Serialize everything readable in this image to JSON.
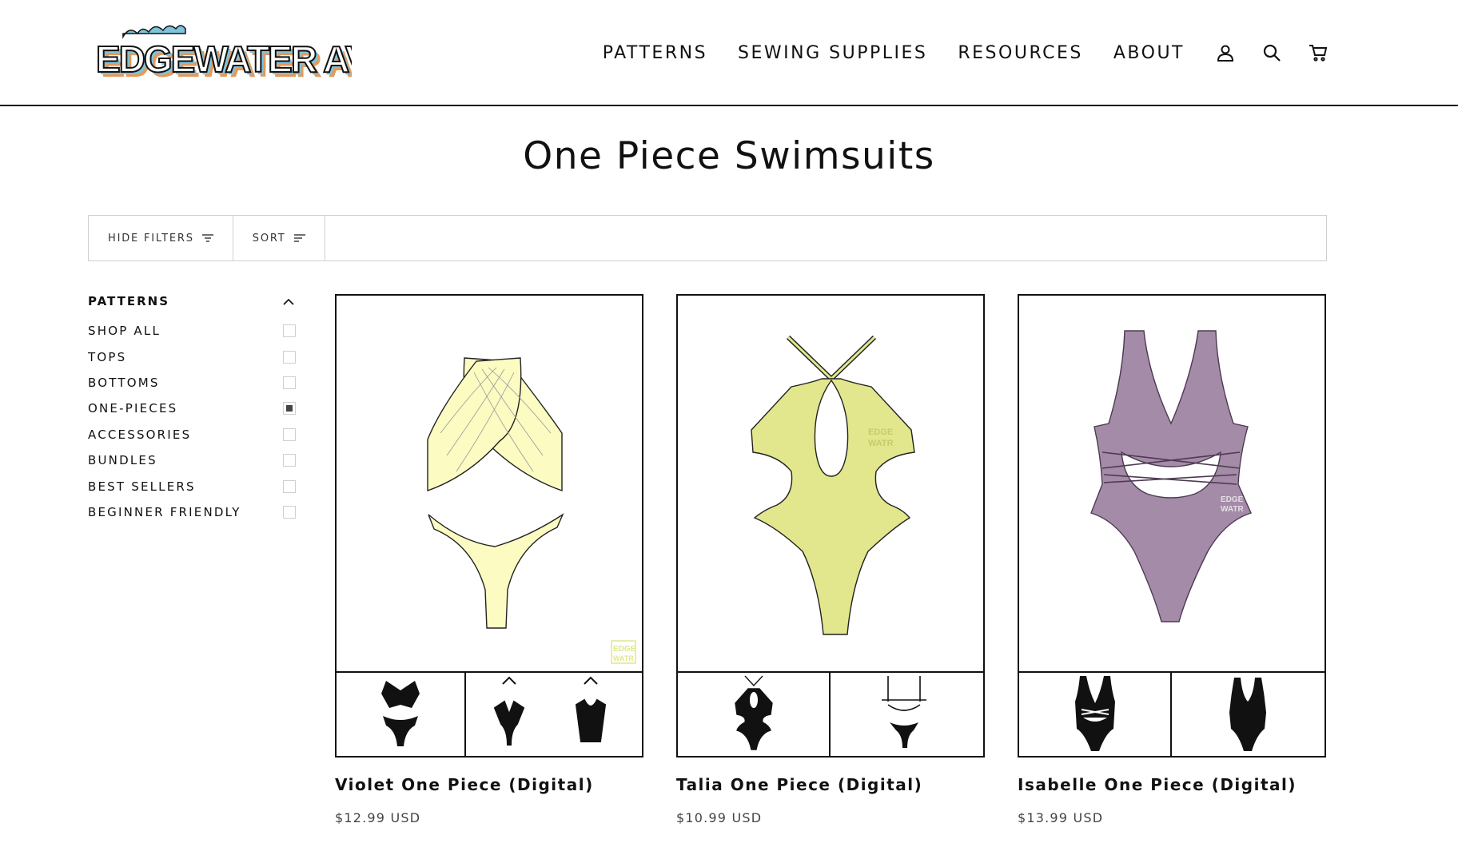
{
  "logo": {
    "text": "EDGEWATER AVE"
  },
  "nav": {
    "items": [
      {
        "label": "PATTERNS"
      },
      {
        "label": "SEWING SUPPLIES"
      },
      {
        "label": "RESOURCES"
      },
      {
        "label": "ABOUT"
      }
    ],
    "icons": [
      "account-icon",
      "search-icon",
      "cart-icon"
    ]
  },
  "page": {
    "title": "One Piece Swimsuits"
  },
  "toolbar": {
    "hide_filters_label": "HIDE FILTERS",
    "sort_label": "SORT"
  },
  "sidebar": {
    "heading": "PATTERNS",
    "filters": [
      {
        "label": "SHOP ALL",
        "checked": false
      },
      {
        "label": "TOPS",
        "checked": false
      },
      {
        "label": "BOTTOMS",
        "checked": false
      },
      {
        "label": "ONE-PIECES",
        "checked": true
      },
      {
        "label": "ACCESSORIES",
        "checked": false
      },
      {
        "label": "BUNDLES",
        "checked": false
      },
      {
        "label": "BEST SELLERS",
        "checked": false
      },
      {
        "label": "BEGINNER FRIENDLY",
        "checked": false
      }
    ]
  },
  "products": [
    {
      "name": "Violet One Piece (Digital)",
      "price": "$12.99 USD",
      "color": "#fbfbc2"
    },
    {
      "name": "Talia One Piece (Digital)",
      "price": "$10.99 USD",
      "color": "#e2e68c"
    },
    {
      "name": "Isabelle One Piece (Digital)",
      "price": "$13.99 USD",
      "color": "#a48ba8"
    }
  ],
  "colors": {
    "text": "#111111",
    "border": "#cfcfcf",
    "logo_blue": "#7fc3dc",
    "logo_orange": "#e59a5a"
  }
}
